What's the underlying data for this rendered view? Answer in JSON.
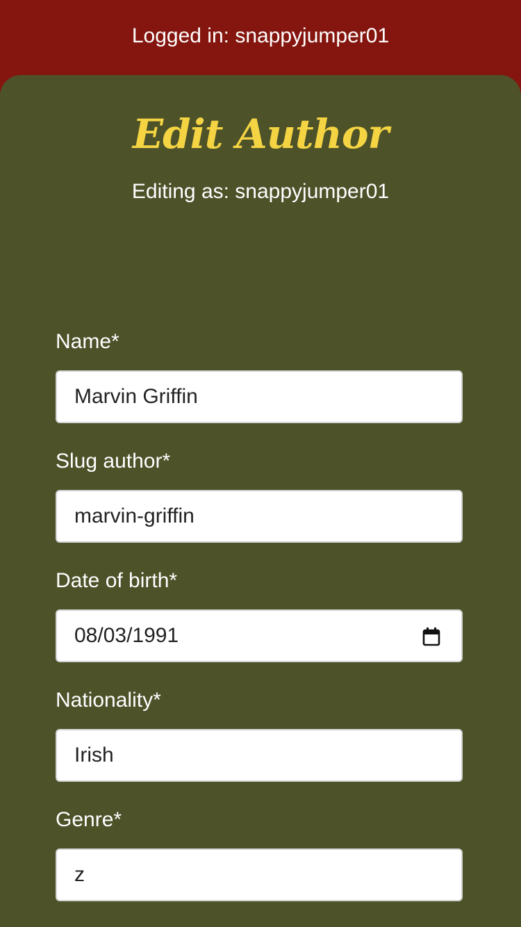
{
  "header": {
    "login_status": "Logged in: snappyjumper01"
  },
  "form": {
    "title": "Edit Author",
    "subtitle": "Editing as: snappyjumper01",
    "fields": [
      {
        "label": "Name*",
        "value": "Marvin Griffin",
        "type": "text"
      },
      {
        "label": "Slug author*",
        "value": "marvin-griffin",
        "type": "text"
      },
      {
        "label": "Date of birth*",
        "value": "08/03/1991",
        "type": "date",
        "icon": "calendar-icon"
      },
      {
        "label": "Nationality*",
        "value": "Irish",
        "type": "text"
      },
      {
        "label": "Genre*",
        "value": "z",
        "type": "text"
      }
    ]
  },
  "colors": {
    "header_bg": "#84160f",
    "panel_bg": "#4d5229",
    "title_accent": "#f5d443"
  }
}
